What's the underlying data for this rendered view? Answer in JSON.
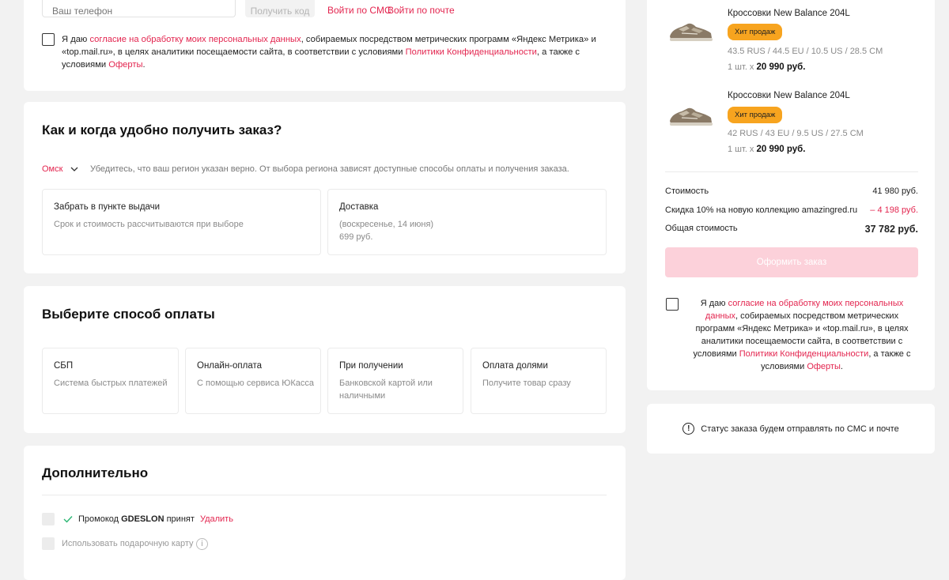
{
  "login": {
    "phone_placeholder": "Ваш телефон",
    "get_code_label": "Получить код",
    "sms_login_label": "Войти по СМС",
    "email_login_label": "Войти по почте"
  },
  "consent": {
    "prefix": "Я даю ",
    "link_consent": "согласие на обработку моих персональных данных",
    "middle": ", собираемых посредством метрических программ «Яндекс Метрика» и «top.mail.ru», в целях аналитики посещаемости сайта, в соответствии с условиями ",
    "link_policy": "Политики Конфиденциальности",
    "after_policy": ", а также с условиями ",
    "link_offer": "Оферты",
    "suffix": "."
  },
  "delivery": {
    "title": "Как и когда удобно получить заказ?",
    "region": "Омск",
    "region_hint": "Убедитесь, что ваш регион указан верно. От выбора региона зависят доступные способы оплаты и получения заказа.",
    "options": [
      {
        "title": "Забрать в пункте выдачи",
        "line1": "Срок и стоимость рассчитываются при выборе",
        "line2": ""
      },
      {
        "title": "Доставка",
        "line1": "(воскресенье, 14 июня)",
        "line2": "699 руб."
      }
    ]
  },
  "payment": {
    "title": "Выберите способ оплаты",
    "options": [
      {
        "title": "СБП",
        "line1": "Система быстрых платежей",
        "line2": ""
      },
      {
        "title": "Онлайн-оплата",
        "line1": "С помощью сервиса ЮКасса",
        "line2": ""
      },
      {
        "title": "При получении",
        "line1": "Банковской картой или",
        "line2": "наличными"
      },
      {
        "title": "Оплата долями",
        "line1": "Получите товар сразу",
        "line2": ""
      }
    ]
  },
  "extra": {
    "title": "Дополнительно",
    "promo_prefix": "Промокод",
    "promo_code": "GDESLON",
    "promo_suffix": "принят",
    "promo_remove": "Удалить",
    "gift_card_label": "Использовать подарочную карту"
  },
  "cart": {
    "items": [
      {
        "name": "Кроссовки New Balance 204L",
        "badge": "Хит продаж",
        "sizes": "43.5 RUS / 44.5 EU / 10.5 US / 28.5 CM",
        "qty": "1 шт.  x",
        "price": "20 990 руб."
      },
      {
        "name": "Кроссовки New Balance 204L",
        "badge": "Хит продаж",
        "sizes": "42 RUS / 43 EU / 9.5 US / 27.5 CM",
        "qty": "1 шт.  x",
        "price": "20 990 руб."
      }
    ],
    "cost_label": "Стоимость",
    "cost_value": "41 980 руб.",
    "discount_label": "Скидка 10% на новую коллекцию amazingred.ru",
    "discount_value": "– 4 198 руб.",
    "total_label": "Общая стоимость",
    "total_value": "37 782 руб.",
    "checkout_label": "Оформить заказ",
    "consent_prefix": "Я даю ",
    "consent_link": "согласие на обработку моих персональных данных",
    "consent_middle": ", собираемых посредством метрических программ «Яндекс Метрика» и «top.mail.ru», в целях аналитики посещаемости сайта, в соответствии с условиями ",
    "consent_policy": "Политики Конфиденциальности",
    "consent_after": ", а также с условиями ",
    "consent_offer": "Оферты",
    "consent_suffix": "."
  },
  "status": {
    "text": "Статус заказа будем отправлять по СМС и почте"
  },
  "colors": {
    "accent": "#e3254f",
    "badge": "#f7a41f",
    "checkout_disabled": "#fcd1da",
    "page_bg": "#f2f2f2"
  }
}
